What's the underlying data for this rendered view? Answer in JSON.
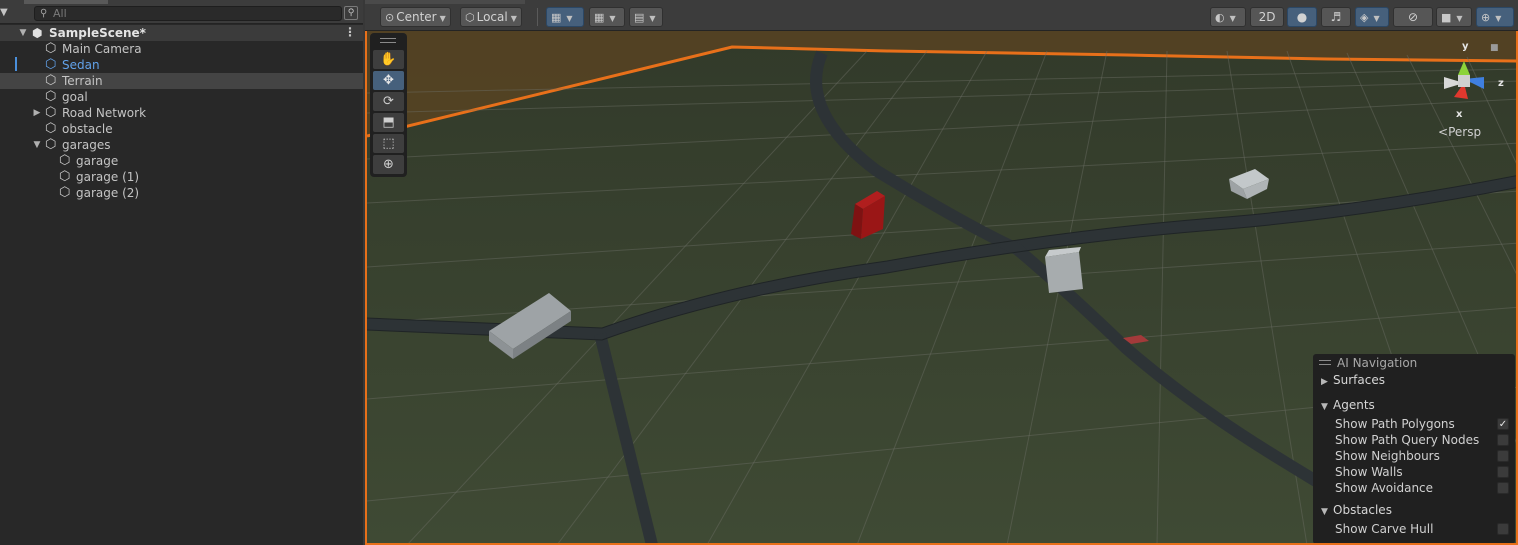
{
  "hierarchy": {
    "search_placeholder": "All",
    "scene": {
      "name": "SampleScene*"
    },
    "items": [
      {
        "label": "Main Camera"
      },
      {
        "label": "Sedan"
      },
      {
        "label": "Terrain"
      },
      {
        "label": "goal"
      },
      {
        "label": "Road Network"
      },
      {
        "label": "obstacle"
      },
      {
        "label": "garages"
      },
      {
        "label": "garage"
      },
      {
        "label": "garage (1)"
      },
      {
        "label": "garage (2)"
      }
    ]
  },
  "scene_toolbar": {
    "pivot_label": "Center",
    "space_label": "Local",
    "mode_2d_label": "2D"
  },
  "gizmo": {
    "projection_label": "Persp",
    "axis_x": "x",
    "axis_y": "y",
    "axis_z": "z"
  },
  "ai_navigation": {
    "title": "AI Navigation",
    "sections": {
      "surfaces": "Surfaces",
      "agents": "Agents",
      "obstacles": "Obstacles"
    },
    "agents_options": [
      {
        "label": "Show Path Polygons",
        "checked": true
      },
      {
        "label": "Show Path Query Nodes",
        "checked": false
      },
      {
        "label": "Show Neighbours",
        "checked": false
      },
      {
        "label": "Show Walls",
        "checked": false
      },
      {
        "label": "Show Avoidance",
        "checked": false
      }
    ],
    "obstacles_options": [
      {
        "label": "Show Carve Hull",
        "checked": false
      }
    ]
  },
  "colors": {
    "selection_outline": "#e8701a",
    "selected_text": "#62a2ea",
    "active_button": "#46607c",
    "ground": "#3c4530"
  },
  "icons": {
    "search": "search-icon",
    "gameobject": "cube-icon",
    "scene": "unity-logo-icon"
  }
}
